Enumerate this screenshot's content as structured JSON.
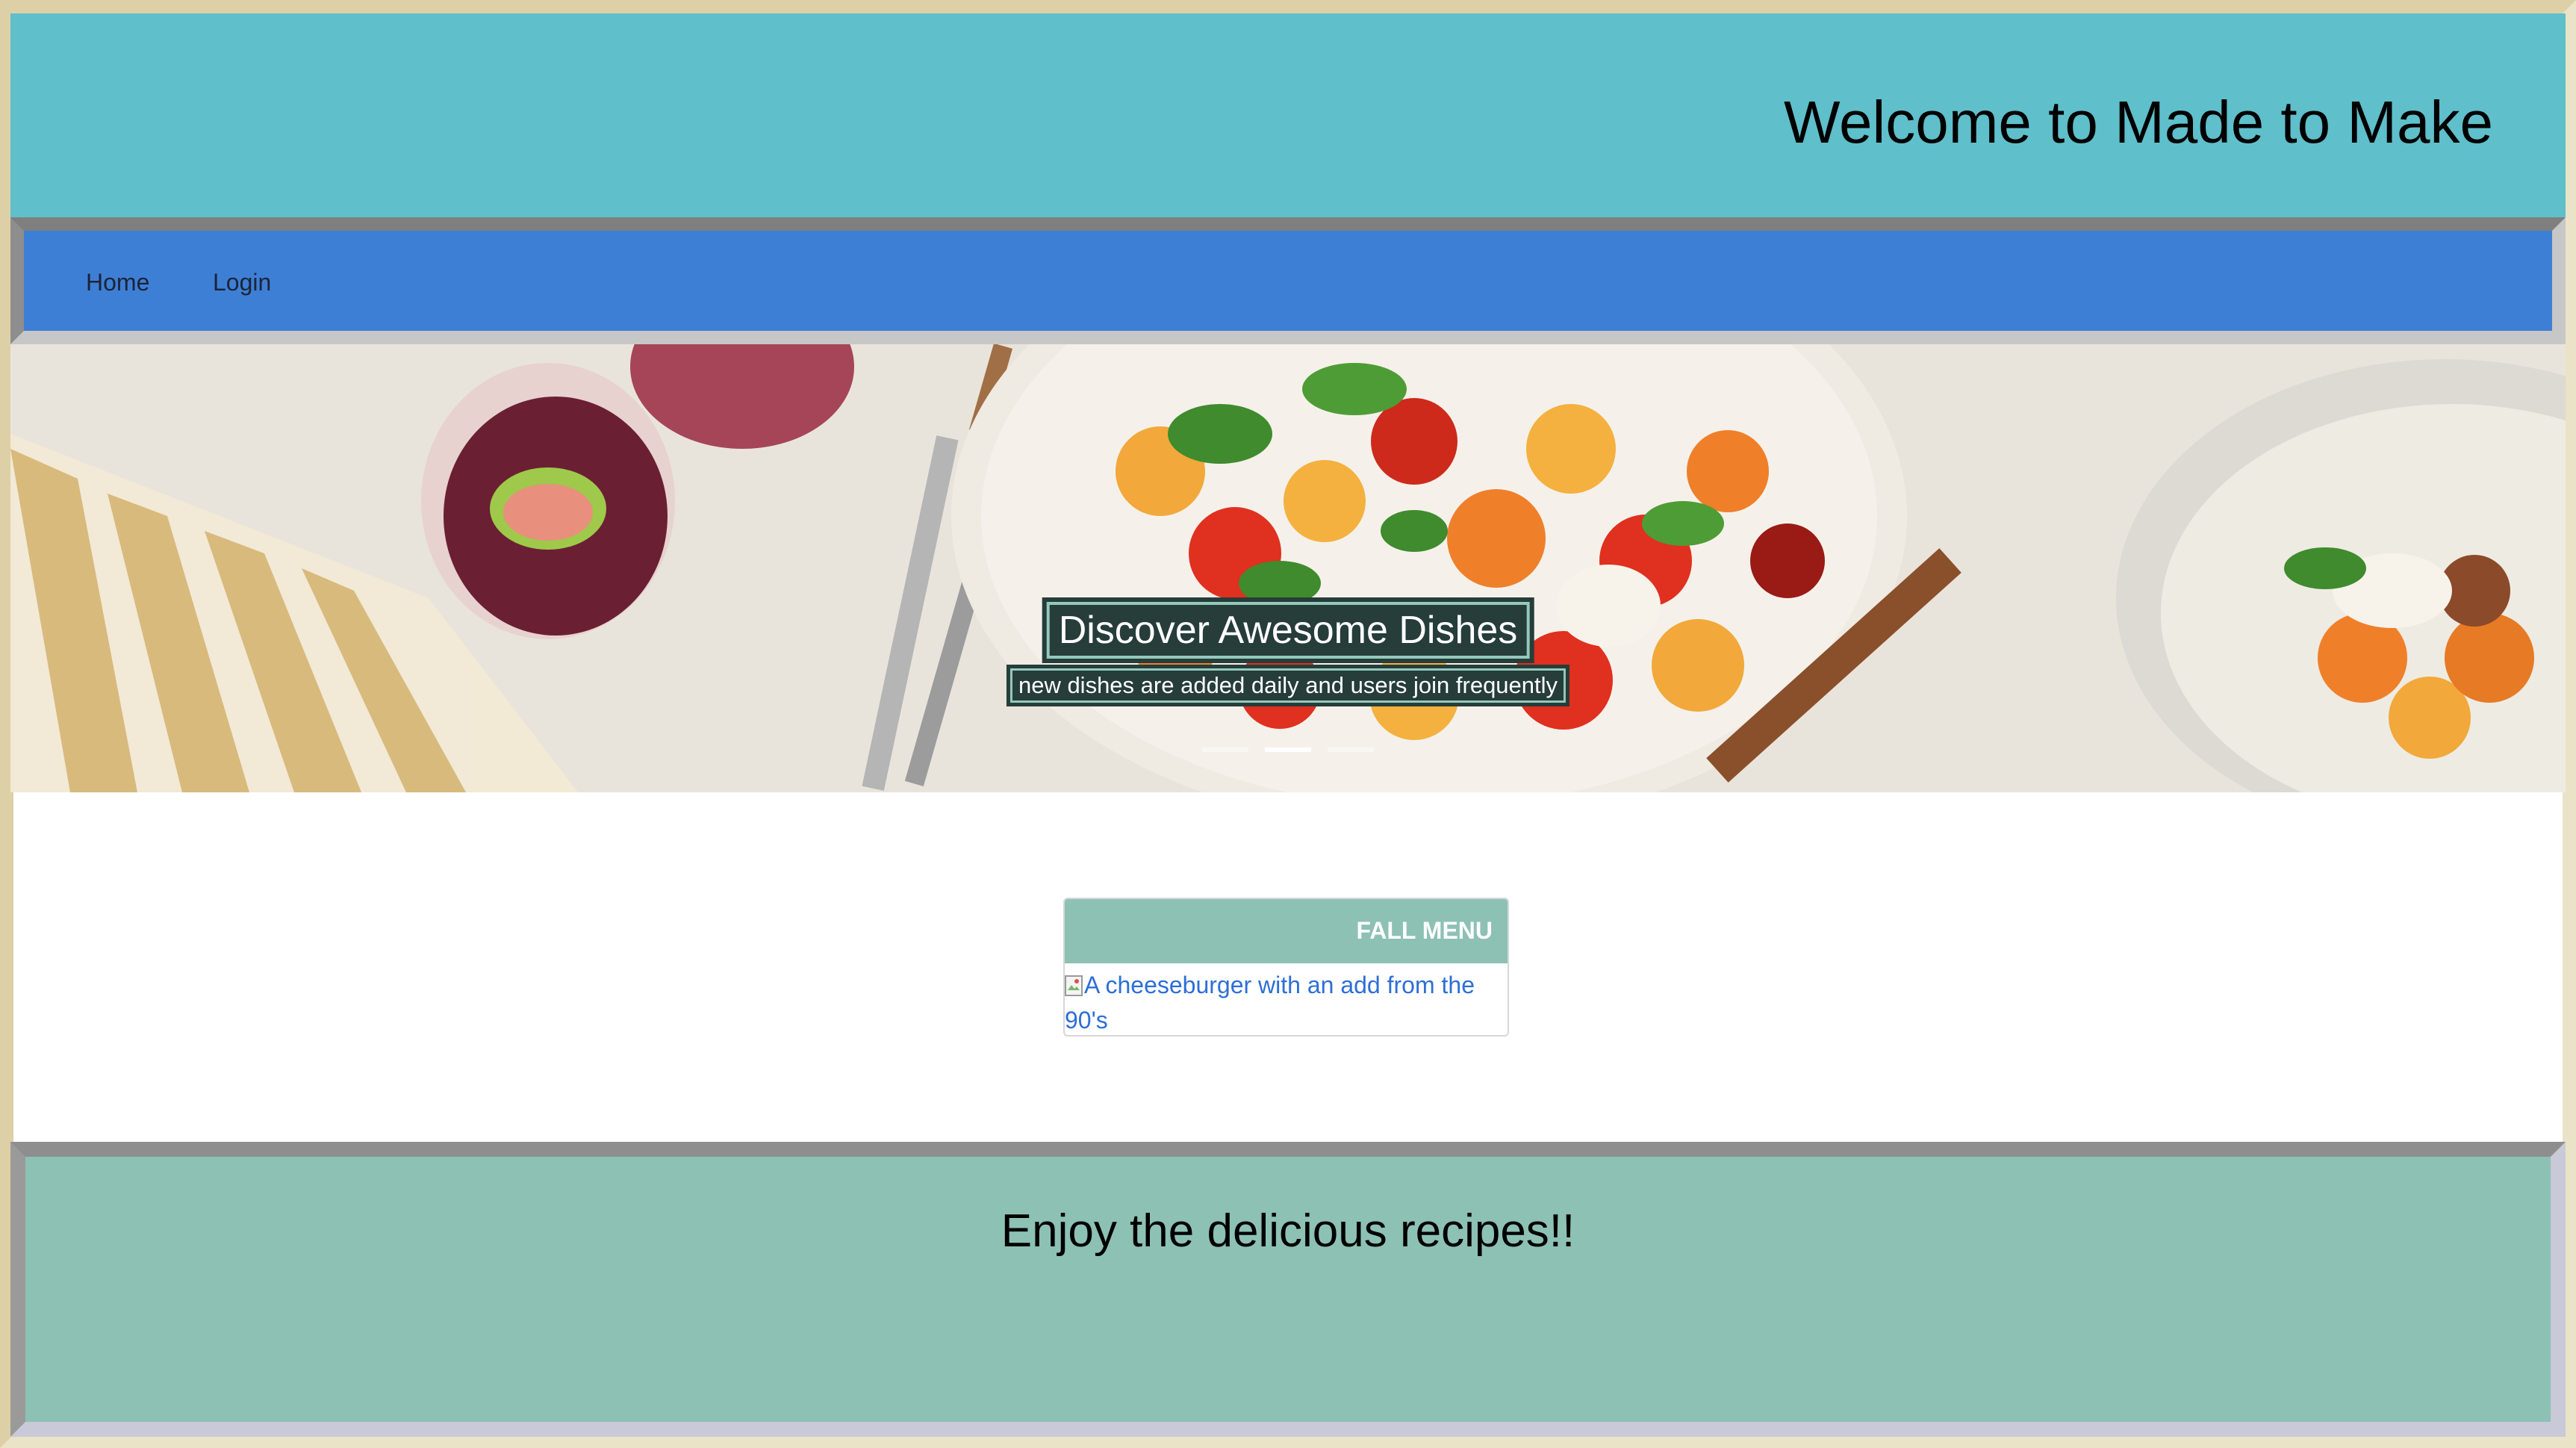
{
  "header": {
    "title": "Welcome to Made to Make"
  },
  "nav": {
    "items": [
      {
        "label": "Home"
      },
      {
        "label": "Login"
      }
    ]
  },
  "hero": {
    "caption_title": "Discover Awesome Dishes",
    "caption_subtitle": "new dishes are added daily and users join frequently",
    "slide_count": 3,
    "active_slide": 2
  },
  "card": {
    "header": "FALL MENU",
    "image_alt": "A cheeseburger with an add from the 90's"
  },
  "footer": {
    "text": "Enjoy the delicious recipes!!"
  },
  "colors": {
    "header_bg": "#5fbfcb",
    "nav_bg": "#3e7fd6",
    "card_header_bg": "#8dc1b4",
    "footer_bg": "#8dc1b4",
    "caption_bg": "#263d3a",
    "link": "#2d6fd6"
  }
}
